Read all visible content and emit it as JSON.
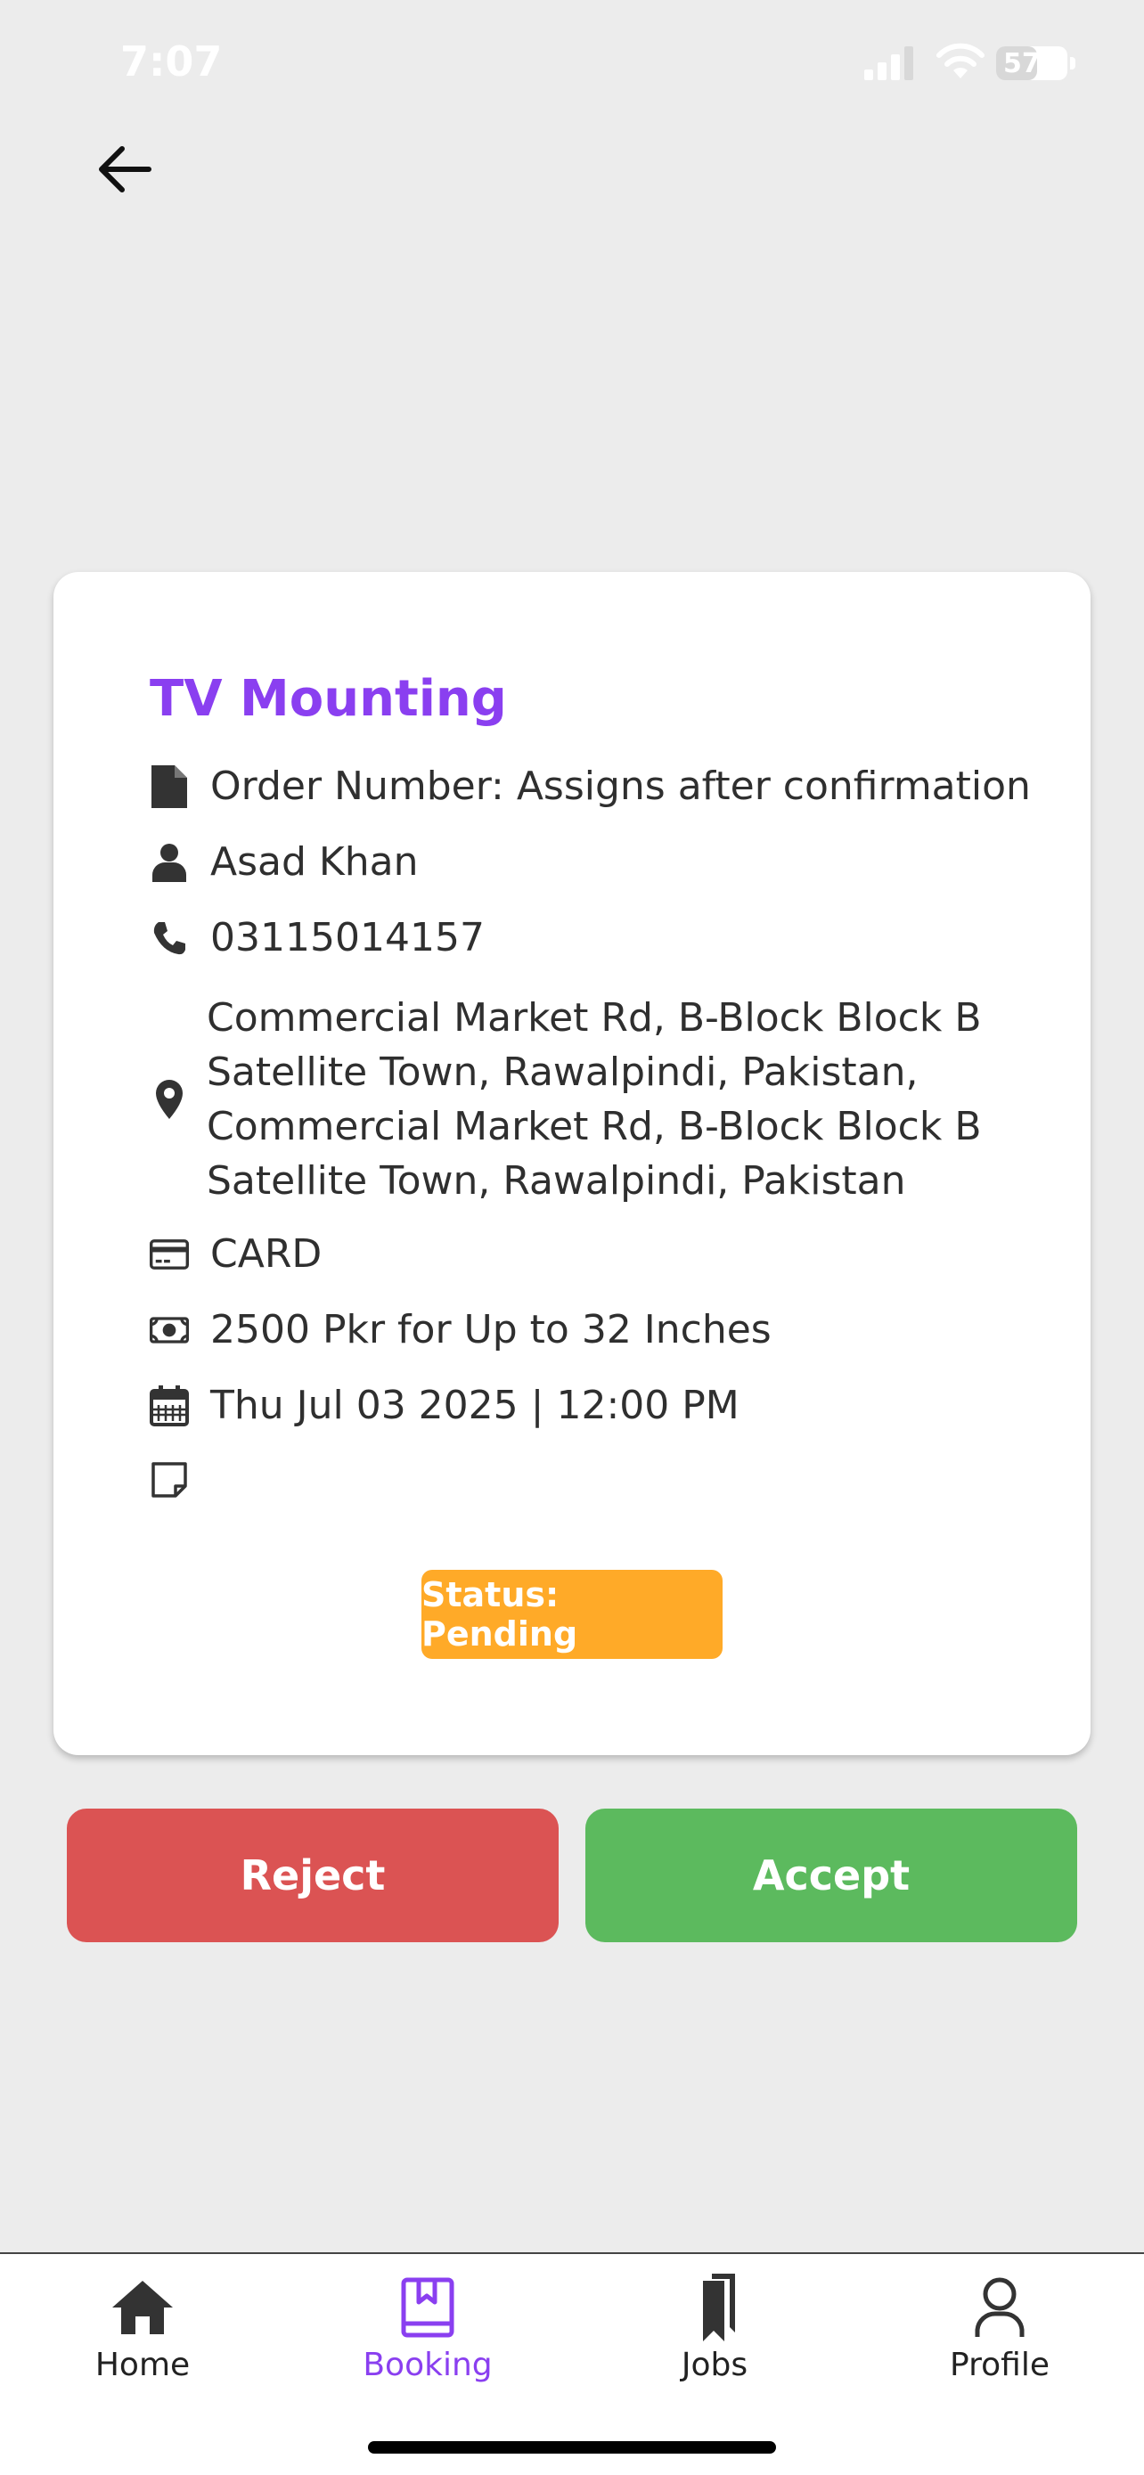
{
  "status_bar": {
    "time": "7:07",
    "battery": "57",
    "battery_level": 0.57
  },
  "header": {
    "back_icon": "arrow-left-icon"
  },
  "booking": {
    "title": "TV Mounting",
    "order_number": "Order Number: Assigns after confirmation",
    "customer_name": "Asad Khan",
    "phone": "03115014157",
    "address": " Commercial Market Rd, B-Block Block B Satellite Town, Rawalpindi, Pakistan, Commercial Market Rd, B-Block Block B Satellite Town, Rawalpindi, Pakistan",
    "payment_method": "CARD",
    "price": "2500 Pkr for Up to 32 Inches",
    "datetime": "Thu Jul 03 2025 | 12:00 PM",
    "note": "",
    "status": "Status: Pending"
  },
  "actions": {
    "reject_label": "Reject",
    "accept_label": "Accept"
  },
  "tabbar": {
    "items": [
      {
        "label": "Home",
        "icon": "home-icon"
      },
      {
        "label": "Booking",
        "icon": "booking-icon",
        "active": true
      },
      {
        "label": "Jobs",
        "icon": "bookmarks-icon"
      },
      {
        "label": "Profile",
        "icon": "user-icon"
      }
    ]
  },
  "colors": {
    "accent": "#8a3ff0",
    "status_pending": "#ffaa28",
    "reject": "#db5353",
    "accept": "#5cba5e",
    "background": "#ececec"
  }
}
